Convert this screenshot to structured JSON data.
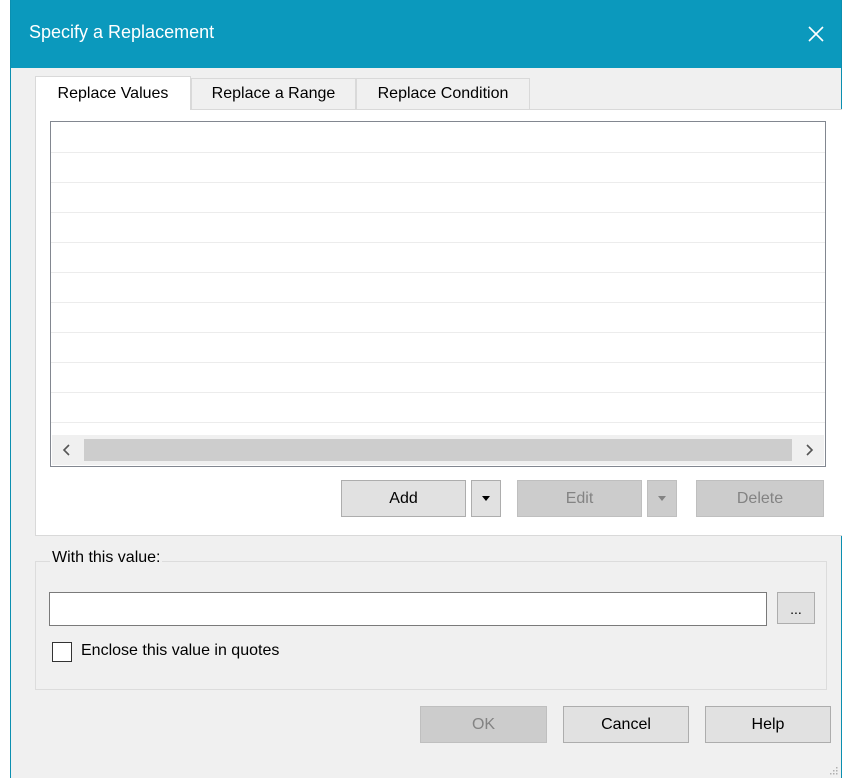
{
  "window": {
    "title": "Specify a Replacement"
  },
  "tabs": [
    {
      "label": "Replace Values",
      "active": true
    },
    {
      "label": "Replace a Range",
      "active": false
    },
    {
      "label": "Replace Condition",
      "active": false
    }
  ],
  "actions": {
    "add": "Add",
    "edit": "Edit",
    "delete": "Delete"
  },
  "with_value": {
    "label": "With this value:",
    "value": "",
    "browse": "...",
    "enclose_quotes_label": "Enclose this value in quotes",
    "enclose_quotes_checked": false
  },
  "footer": {
    "ok": "OK",
    "cancel": "Cancel",
    "help": "Help"
  },
  "icons": [
    "close-icon",
    "chevron-left-icon",
    "chevron-right-icon",
    "dropdown-arrow-icon",
    "resize-grip-icon"
  ],
  "colors": {
    "titlebar": "#0b99bd",
    "dialog_bg": "#f0f0f0"
  }
}
